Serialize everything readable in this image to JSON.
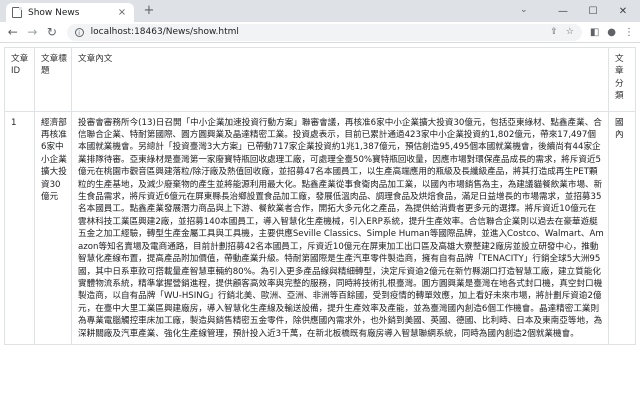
{
  "browser": {
    "tab_title": "Show News",
    "tab_close": "×",
    "new_tab": "+",
    "url": "localhost:18463/News/show.html",
    "icons": [
      "back-icon",
      "forward-icon",
      "reload-icon",
      "info-icon",
      "share-icon",
      "star-icon",
      "extensions-icon",
      "profile-icon",
      "menu-icon"
    ]
  },
  "table": {
    "headers": {
      "id": "文章ID",
      "title": "文章標題",
      "content": "文章內文",
      "category": "文章分類"
    },
    "rows": [
      {
        "id": "1",
        "title": "經濟部再核准6家中小企業擴大投資30億元",
        "content": "投審會審務所今(13)日召開「中小企業加速投資行動方案」聯審會議，再核准6家中小企業擴大投資30億元，包括亞東綠材、點鑫產業、合信聯合企業、特耐第國際、圓方圓興業及晶達精密工業。投資處表示，目前已累計通過423家中小企業投資約1,802億元，帶來17,497個本國就業機會。另總計「投資臺灣3大方案」已帶動717家企業投資約1兆1,387億元，預估創造95,495個本國就業機會，後續尚有44家企業排隊待審。亞東綠材是臺灣第一家廢寶特瓶回收處理工廠，可處理全臺50%寶特瓶回收量，因應市場對環保產品成長的需求，將斥資近5億元在桃園市觀音區興建落粒/除汙廠及熱值回收廠，並招募47名本國員工，以生產高端應用的瓶級及長纖級產品，將其打造成再生PET顆粒的生產基地，及減少廢棄物的產生並將能源利用最大化。點鑫產業從事食衛肉品加工業，以國內市場銷售為主，為建議貓餐飲業市場、新生食品需求，將斥資近6億元在屏東縣長治鄉設置食品加工廠，發展低溫肉品、調理食品及烘焙食品，滿足日益增長的市場需求，並招募35名本國員工。點鑫產業發展潛力商品與上下游、餐飲業者合作，開拓大多元化之產品，為提供給消費者更多元的選擇。將斥資近10億元在雲林科技工業區興建2廠，並招募140本國員工，導入智慧化生產機械，引入ERP系統，提升生產效率。合信聯合企業則以過去在豪華遊艇五金之加工經驗，轉型生產金屬工具與工具機，主要供應Seville Classics、Simple Human等國際品牌，並進入Costco、Walmart、Amazon等知名賣場及電商通路，目前計劃招募42名本國員工，斥資近10億元在屏東加工出口區及高雄大寮整建2廠房並設立研發中心，推動智慧化產線布置，提高產品附加價值，帶動產業升級。特耐第國際是生產汽車零件製造商，擁有自有品牌「TENACITY」行銷全球5大洲95國，其中日系車款可搭載量產智慧車輛約80%。為引入更多產品線與精細轉型，決定斥資逾2億元在新竹縣湖口打造智慧工廠，建立質能化實體物流系統，精準掌握營銷進程，提供顧客高效率與完整的服務，同時將技術扎根臺灣。圓方圓興業是臺灣在地各式封口機，真空封口機製造商，以自有品牌「WU-HSING」行銷北美、歐洲、亞洲、非洲等百餘國，受到疫情的轉單效應，加上看好未來市場，將計劃斥資逾2億元，在臺中大里工業區興建廠房，導入智慧化生產線及輸送設備，提升生產效率及產能，並為臺灣國內創造6個工作機會。晶達精密工業則為專業電腦觸控車床加工廠，製造與銷售精密五金零件，除供應國內需求外，也外銷到美國、英國、德國、比利時、日本及東南亞等地，為深耕關廠及汽車產業、強化生產線管理，預計投入近3千萬，在新北板橋既有廠房導入智慧聯網系統，同時為國內創造2個就業機會。",
        "category": "國內"
      }
    ]
  }
}
